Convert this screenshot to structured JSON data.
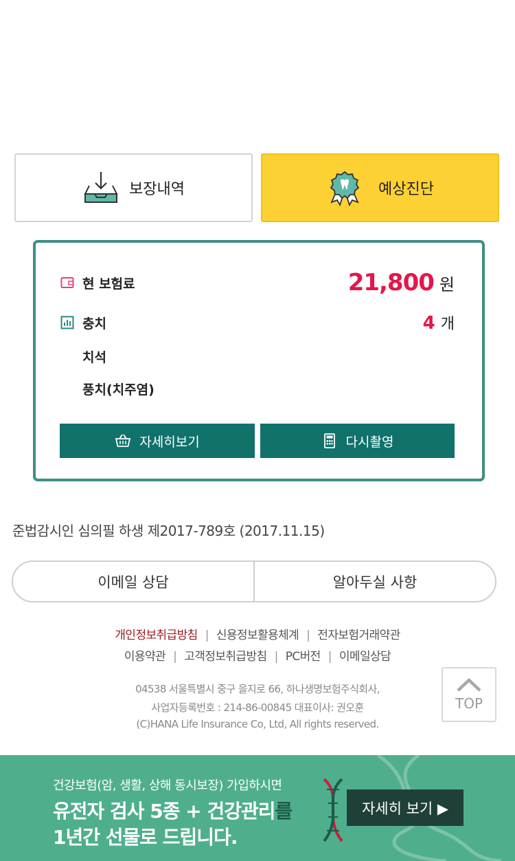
{
  "tabs": {
    "coverage_label": "보장내역",
    "diagnosis_label": "예상진단"
  },
  "summary": {
    "premium_label": "현 보험료",
    "premium_value": "21,800",
    "premium_unit": "원",
    "cavity_label": "충치",
    "cavity_count": "4",
    "cavity_unit": "개",
    "item_tartar": "치석",
    "item_periodontitis": "풍치(치주염)",
    "details_button": "자세히보기",
    "retake_button": "다시촬영"
  },
  "notice": "준법감시인 심의필 하생 제2017-789호 (2017.11.15)",
  "contact": {
    "email_label": "이메일 상담",
    "notes_label": "알아두실 사항"
  },
  "footer": {
    "link1": "개인정보취급방침",
    "link2": "신용정보활용체계",
    "link3": "전자보험거래약관",
    "link4": "이용약관",
    "link5": "고객정보취급방침",
    "link6": "PC버전",
    "link7": "이메일상담",
    "address": "04538 서울특별시 중구 을지로 66, 하나생명보험주식회사,",
    "registration": "사업자등록번호 : 214-86-00845 대표이사: 권오훈",
    "copyright": "(C)HANA Life Insurance Co, Ltd, All rights reserved."
  },
  "top_button": "TOP",
  "banner": {
    "line1": "건강보험(암, 생활, 상해 동시보장) 가입하시면",
    "line2_a": "유전자 검사 5종 + 건강관리",
    "line2_b": "를",
    "line3": "1년간 선물로 드립니다.",
    "cta": "자세히 보기 ▶"
  },
  "colors": {
    "accent_teal": "#10726b",
    "highlight_red": "#e4164a",
    "tab_yellow": "#fdd133",
    "banner_green": "#4faf8c"
  }
}
